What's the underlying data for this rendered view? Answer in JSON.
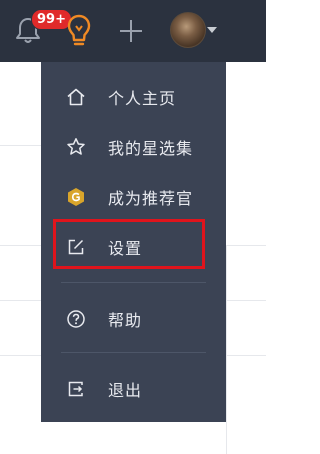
{
  "header": {
    "notification_badge": "99+",
    "icons": [
      "bell-icon",
      "lightbulb-icon",
      "plus-icon",
      "avatar",
      "caret-down-icon"
    ]
  },
  "menu": {
    "items": [
      {
        "label": "个人主页",
        "icon": "home-icon"
      },
      {
        "label": "我的星选集",
        "icon": "star-icon"
      },
      {
        "label": "成为推荐官",
        "icon": "recommender-badge-icon"
      },
      {
        "label": "设置",
        "icon": "edit-icon",
        "highlighted": true
      },
      {
        "label": "帮助",
        "icon": "help-icon"
      },
      {
        "label": "退出",
        "icon": "logout-icon"
      }
    ]
  },
  "colors": {
    "topbar": "#2b323f",
    "menu_bg": "#3b4354",
    "menu_text": "#e8eaef",
    "badge": "#e02a2a",
    "bulb": "#f08a24",
    "highlight": "#e0141c",
    "recommender_badge": "#d9a52b"
  }
}
